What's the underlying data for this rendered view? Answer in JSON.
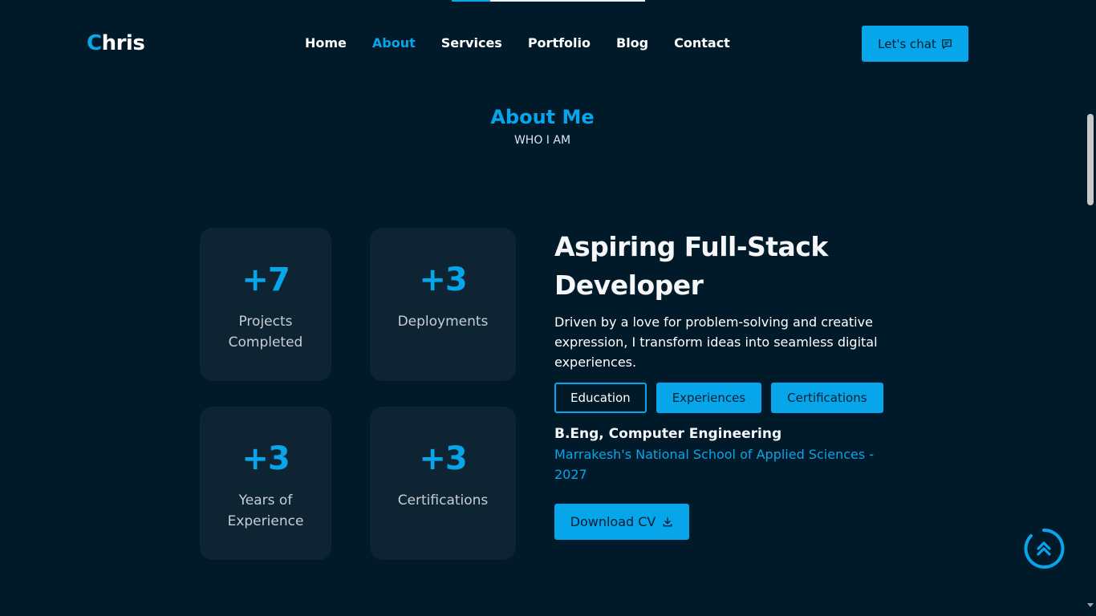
{
  "header": {
    "logo_accent": "C",
    "logo_rest": "hris",
    "nav": [
      "Home",
      "About",
      "Services",
      "Portfolio",
      "Blog",
      "Contact"
    ],
    "active_nav": "About",
    "chat_button": "Let's chat",
    "chat_icon": "chat-icon"
  },
  "section": {
    "title": "About Me",
    "subtitle": "WHO I AM"
  },
  "stats": [
    {
      "value": "+7",
      "label": "Projects Completed"
    },
    {
      "value": "+3",
      "label": "Deployments"
    },
    {
      "value": "+3",
      "label": "Years of Experience"
    },
    {
      "value": "+3",
      "label": "Certifications"
    }
  ],
  "about": {
    "heading": "Aspiring Full-Stack Developer",
    "description": "Driven by a love for problem-solving and creative expression, I transform ideas into seamless digital experiences.",
    "tabs": [
      "Education",
      "Experiences",
      "Certifications"
    ],
    "active_tab": "Education",
    "education_title": "B.Eng, Computer Engineering",
    "education_school": "Marrakesh's National School of Applied Sciences - 2027",
    "download_button": "Download CV",
    "download_icon": "download-icon"
  },
  "colors": {
    "background": "#011a2a",
    "accent": "#07a5ea",
    "card": "#0f2433"
  },
  "scroll_top_icon": "double-chevron-up-icon"
}
